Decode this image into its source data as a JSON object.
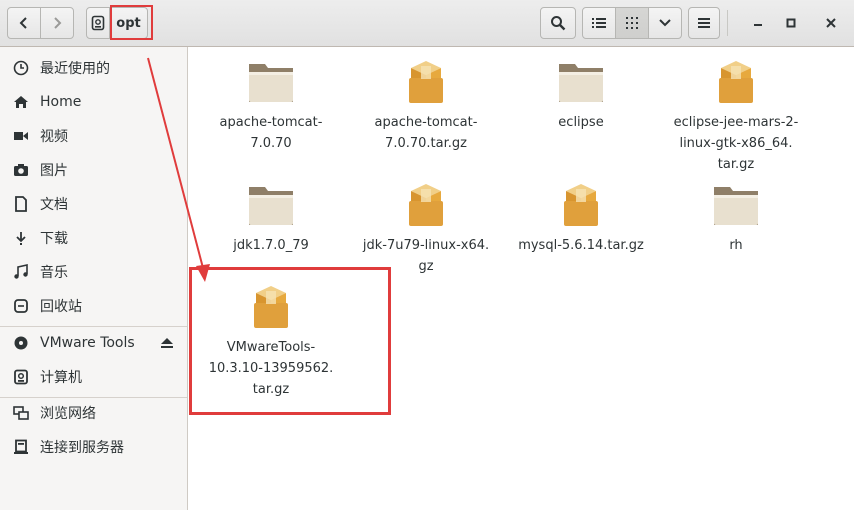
{
  "header": {
    "path_current": "opt",
    "icons": {
      "back": "chevron-left-icon",
      "forward": "chevron-right-icon",
      "device": "drive-icon",
      "search": "search-icon",
      "list_view": "list-view-icon",
      "grid_view": "grid-view-icon",
      "view_options": "chevron-down-icon",
      "menu": "hamburger-icon",
      "minimize": "minimize-icon",
      "maximize": "maximize-icon",
      "close": "close-icon"
    }
  },
  "sidebar": {
    "items": [
      {
        "label": "最近使用的",
        "icon": "clock-icon"
      },
      {
        "label": "Home",
        "icon": "home-icon"
      },
      {
        "label": "视频",
        "icon": "video-icon"
      },
      {
        "label": "图片",
        "icon": "camera-icon"
      },
      {
        "label": "文档",
        "icon": "document-icon"
      },
      {
        "label": "下载",
        "icon": "download-icon"
      },
      {
        "label": "音乐",
        "icon": "music-icon"
      },
      {
        "label": "回收站",
        "icon": "trash-icon"
      },
      {
        "label": "VMware Tools",
        "icon": "disc-icon"
      },
      {
        "label": "计算机",
        "icon": "computer-icon"
      },
      {
        "label": "浏览网络",
        "icon": "network-icon"
      },
      {
        "label": "连接到服务器",
        "icon": "server-icon"
      }
    ]
  },
  "files": [
    {
      "name": "apache-tomcat-\n7.0.70",
      "type": "folder"
    },
    {
      "name": "apache-tomcat-\n7.0.70.tar.gz",
      "type": "archive"
    },
    {
      "name": "eclipse",
      "type": "folder"
    },
    {
      "name": "eclipse-jee-mars-2-\nlinux-gtk-x86_64.\ntar.gz",
      "type": "archive"
    },
    {
      "name": "jdk1.7.0_79",
      "type": "folder"
    },
    {
      "name": "jdk-7u79-linux-x64.\ngz",
      "type": "archive"
    },
    {
      "name": "mysql-5.6.14.tar.gz",
      "type": "archive"
    },
    {
      "name": "rh",
      "type": "folder"
    },
    {
      "name": "VMwareTools-\n10.3.10-13959562.\ntar.gz",
      "type": "archive"
    }
  ],
  "colors": {
    "annotation": "#e03c3c",
    "folder_body": "#e8e0cf",
    "folder_tab": "#8f7f68",
    "archive_body": "#e0a03c"
  }
}
